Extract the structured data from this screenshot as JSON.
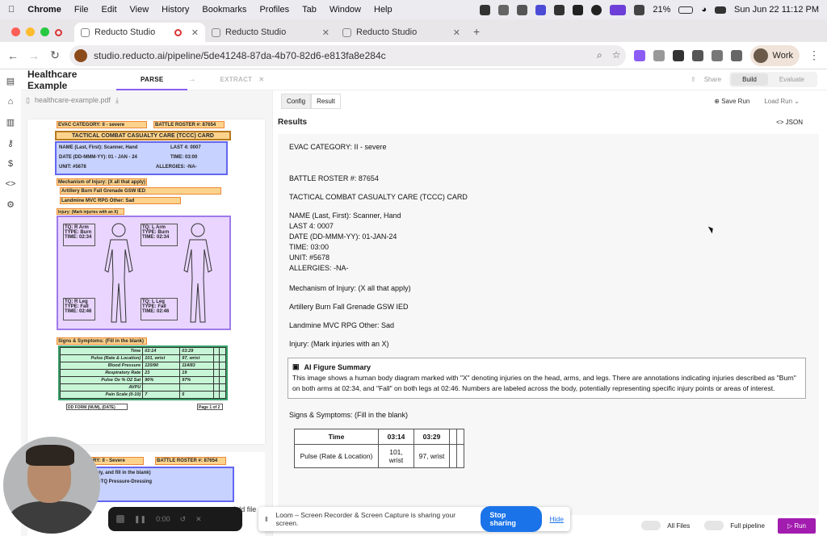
{
  "menubar": {
    "apple": "",
    "app": "Chrome",
    "items": [
      "File",
      "Edit",
      "View",
      "History",
      "Bookmarks",
      "Profiles",
      "Tab",
      "Window",
      "Help"
    ],
    "battery": "21%",
    "datetime": "Sun Jun 22  11:12 PM"
  },
  "browser": {
    "tabs": [
      "Reducto Studio",
      "Reducto Studio",
      "Reducto Studio"
    ],
    "url": "studio.reducto.ai/pipeline/5de41248-87da-4b70-82d6-e813fa8e284c",
    "profile": "Work"
  },
  "app": {
    "project_title": "Healthcare Example",
    "steps": [
      "PARSE",
      "EXTRACT"
    ],
    "share": "Share",
    "modes": [
      "Build",
      "Evaluate"
    ],
    "file_name": "healthcare-example.pdf",
    "tabs": [
      "Config",
      "Result"
    ],
    "save_run": "Save Run",
    "load_run": "Load Run",
    "results_title": "Results",
    "json": "JSON",
    "add_file": "Add file",
    "all_files": "All Files",
    "full_pipeline": "Full pipeline",
    "run": "Run"
  },
  "doc": {
    "evac": "EVAC CATEGORY:  II - severe",
    "roster": "BATTLE ROSTER #:  87654",
    "card_title": "TACTICAL COMBAT CASUALTY CARE (TCCC) CARD",
    "name": "NAME (Last, First):  Scanner, Hand",
    "last4": "LAST 4: 0007",
    "date": "DATE (DD-MMM-YY):  01 - JAN - 24",
    "time": "TIME:  03:00",
    "unit": "UNIT: #5678",
    "allergies": "ALLERGIES:  -NA-",
    "mechanism": "Mechanism of Injury: (X all that apply)",
    "mech_row1": "Artillery  Burn  Fall  Grenade  GSW  IED",
    "mech_row2": "Landmine  MVC  RPG  Other: Sad",
    "injury": "Injury: (Mark injuries with an X)",
    "tq_r_arm": "TQ: R Arm  TYPE: Burn  TIME: 02:34",
    "tq_l_arm": "TQ: L Arm  TYPE: Burn  TIME: 02:34",
    "tq_r_leg": "TQ: R Leg  TYPE: Fall  TIME: 02:46",
    "tq_l_leg": "TQ: L Leg  TYPE: Fall  TIME: 02:46",
    "signs": "Signs & Symptoms: (Fill in the blank)",
    "vitals": [
      [
        "Time",
        "03:14",
        "03:29"
      ],
      [
        "Pulse (Rate & Location)",
        "101, wrist",
        "97, wrist"
      ],
      [
        "Blood Pressure",
        "120/90",
        "114/83"
      ],
      [
        "Respiratory Rate",
        "23",
        "19"
      ],
      [
        "Pulse Ox % O2 Sat",
        "90%",
        "97%"
      ],
      [
        "AVPU",
        "",
        ""
      ],
      [
        "Pain Scale (0-10)",
        "7",
        "5"
      ]
    ],
    "footer": "DD FORM (NUM), (DATE)",
    "page": "Page 1 of 2",
    "p2_evac": "EVAC CATEGORY:  II - Severe",
    "p2_roster": "BATTLE ROSTER #:  87654",
    "p2_line": "TQ   (X all that apply, and fill in the blank)",
    "p2_line2": "Ry-TQ   Junctional-TQ   Pressure-Dressing"
  },
  "results": {
    "paras": [
      "EVAC CATEGORY: II - severe",
      "BATTLE ROSTER #: 87654",
      "TACTICAL COMBAT CASUALTY CARE (TCCC) CARD"
    ],
    "block": [
      "NAME (Last, First): Scanner, Hand",
      "LAST 4: 0007",
      "DATE (DD-MMM-YY): 01-JAN-24",
      "TIME: 03:00",
      "UNIT: #5678",
      "ALLERGIES: -NA-"
    ],
    "paras2": [
      "Mechanism of Injury: (X all that apply)",
      "Artillery Burn Fall Grenade GSW IED",
      "Landmine MVC RPG Other: Sad",
      "Injury: (Mark injuries with an X)"
    ],
    "figure_title": "AI Figure Summary",
    "figure_text": "This image shows a human body diagram marked with \"X\" denoting injuries on the head, arms, and legs. There are annotations indicating injuries described as \"Burn\" on both arms at 02:34, and \"Fall\" on both legs at 02:46. Numbers are labeled across the body, potentially representing specific injury points or areas of interest.",
    "signs": "Signs & Symptoms: (Fill in the blank)",
    "table": [
      [
        "Time",
        "03:14",
        "03:29"
      ],
      [
        "Pulse (Rate & Location)",
        "101, wrist",
        "97, wrist"
      ]
    ]
  },
  "loom": {
    "timer": "0:00",
    "message": "Loom – Screen Recorder & Screen Capture is sharing your screen.",
    "stop": "Stop sharing",
    "hide": "Hide"
  }
}
